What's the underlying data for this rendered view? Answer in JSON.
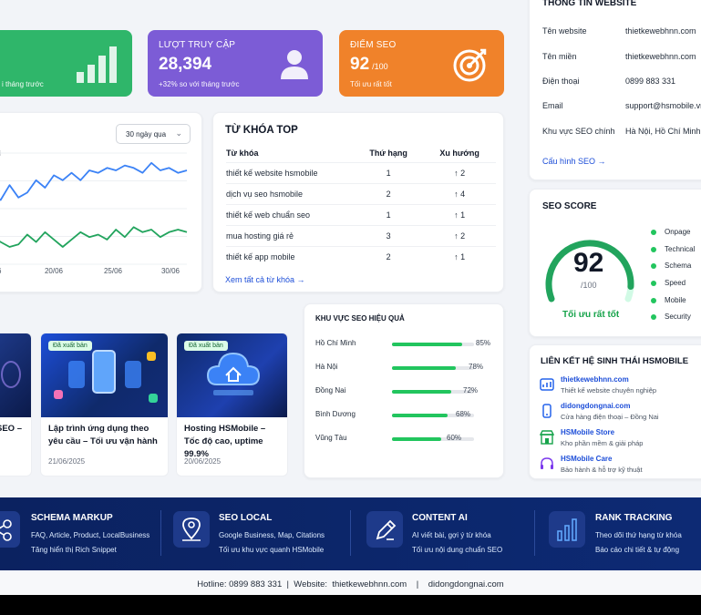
{
  "stats": [
    {
      "label": "",
      "value": "",
      "sub": "i tháng trước",
      "color": "#2fb66a"
    },
    {
      "label": "LƯỢT TRUY CẬP",
      "value": "28,394",
      "sub": "+32% so với tháng trước",
      "color": "#7c5cd6"
    },
    {
      "label": "ĐIỂM SEO",
      "value": "92",
      "value_unit": "/100",
      "sub": "Tối ưu rất tốt",
      "color": "#f0822a"
    }
  ],
  "info": {
    "title": "THÔNG TIN WEBSITE",
    "rows": [
      {
        "k": "Tên website",
        "v": "thietkewebhnn.com"
      },
      {
        "k": "Tên miền",
        "v": "thietkewebhnn.com"
      },
      {
        "k": "Điện thoại",
        "v": "0899 883 331"
      },
      {
        "k": "Email",
        "v": "support@hsmobile.vn"
      },
      {
        "k": "Khu vực SEO chính",
        "v": "Hà Nội, Hồ Chí Minh,"
      }
    ],
    "config_link": "Cấu hình SEO  →"
  },
  "traffic": {
    "range_select": "30 ngày qua",
    "y_label_fragment": "i",
    "x_ticks": [
      "6",
      "20/06",
      "25/06",
      "30/06"
    ]
  },
  "chart_data": {
    "type": "line",
    "x": [
      "6",
      "20/06",
      "25/06",
      "30/06"
    ],
    "series": [
      {
        "values": [
          212,
          214,
          208,
          213,
          211,
          206,
          209,
          204,
          206,
          203,
          206,
          202,
          203,
          201,
          202,
          200,
          201,
          203,
          199,
          202,
          201,
          203,
          202
        ]
      },
      {
        "values": [
          229,
          231,
          233,
          232,
          228,
          231,
          227,
          230,
          233,
          230,
          227,
          229,
          228,
          230,
          226,
          229,
          225,
          227,
          226,
          229,
          227,
          226,
          227
        ]
      }
    ],
    "colors": [
      "#3b82f6",
      "#22a45d"
    ],
    "grid": true
  },
  "keywords": {
    "title": "TỪ KHÓA TOP",
    "headers": [
      "Từ khóa",
      "Thứ hạng",
      "Xu hướng"
    ],
    "rows": [
      {
        "kw": "thiết kế website hsmobile",
        "rank": "1",
        "trend": "↑ 2"
      },
      {
        "kw": "dịch vụ seo hsmobile",
        "rank": "2",
        "trend": "↑ 4"
      },
      {
        "kw": "thiết kế web chuẩn seo",
        "rank": "1",
        "trend": "↑ 1"
      },
      {
        "kw": "mua hosting giá rẻ",
        "rank": "3",
        "trend": "↑ 2"
      },
      {
        "kw": "thiết kế app mobile",
        "rank": "2",
        "trend": "↑ 1"
      }
    ],
    "see_all": "Xem tất cả từ khóa  →"
  },
  "seo_score": {
    "title": "SEO SCORE",
    "value": "92",
    "unit": "/100",
    "fraction": 0.92,
    "status": "Tối ưu rất tốt",
    "legend": [
      "Onpage",
      "Technical",
      "Schema",
      "Speed",
      "Mobile",
      "Security"
    ]
  },
  "posts": [
    {
      "badge": "",
      "title": "SEO –",
      "date": ""
    },
    {
      "badge": "Đã xuất bản",
      "title": "Lập trình ứng dụng theo yêu cầu – Tối ưu vận hành",
      "date": "21/06/2025"
    },
    {
      "badge": "Đã xuất bản",
      "title": "Hosting HSMobile – Tốc độ cao, uptime 99.9%",
      "date": "20/06/2025"
    }
  ],
  "regions": {
    "title": "KHU VỰC SEO HIỆU QUẢ",
    "rows": [
      {
        "name": "Hồ Chí Minh",
        "pct": "85%",
        "value": 85
      },
      {
        "name": "Hà Nội",
        "pct": "78%",
        "value": 78
      },
      {
        "name": "Đồng Nai",
        "pct": "72%",
        "value": 72
      },
      {
        "name": "Bình Dương",
        "pct": "68%",
        "value": 68
      },
      {
        "name": "Vũng Tàu",
        "pct": "60%",
        "value": 60
      }
    ]
  },
  "ecosystem": {
    "title": "LIÊN KẾT HỆ SINH THÁI HSMOBILE",
    "items": [
      {
        "name": "thietkewebhnn.com",
        "desc": "Thiết kế website chuyên nghiệp",
        "icon": "chart-icon"
      },
      {
        "name": "didongdongnai.com",
        "desc": "Cửa hàng điện thoại – Đồng Nai",
        "icon": "phone-icon"
      },
      {
        "name": "HSMobile Store",
        "desc": "Kho phần mềm & giải pháp",
        "icon": "store-icon"
      },
      {
        "name": "HSMobile Care",
        "desc": "Bảo hành & hỗ trợ kỹ thuật",
        "icon": "headset-icon"
      }
    ]
  },
  "features": [
    {
      "title": "SCHEMA MARKUP",
      "l1": "FAQ, Article, Product, LocalBusiness",
      "l2": "Tăng hiển thị Rich Snippet",
      "icon": "schema-icon"
    },
    {
      "title": "SEO LOCAL",
      "l1": "Google Business, Map, Citations",
      "l2": "Tối ưu khu vực quanh HSMobile",
      "icon": "map-pin-icon"
    },
    {
      "title": "CONTENT AI",
      "l1": "AI viết bài, gợi ý từ khóa",
      "l2": "Tối ưu nội dung chuẩn SEO",
      "icon": "pen-icon"
    },
    {
      "title": "RANK TRACKING",
      "l1": "Theo dõi thứ hạng từ khóa",
      "l2": "Báo cáo chi tiết & tự động",
      "icon": "bar-chart-icon"
    }
  ],
  "footer": {
    "text": "Hotline: 0899 883 331  |  Website:  thietkewebhnn.com    |    didongdongnai.com"
  }
}
